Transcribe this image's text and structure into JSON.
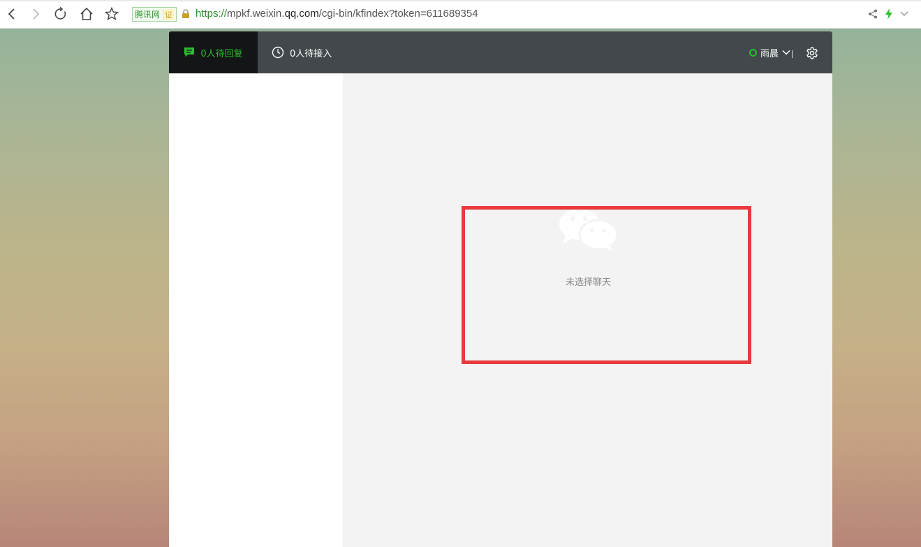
{
  "browser": {
    "cert_label": "腾讯网",
    "cert_mark": "证",
    "url_scheme": "https://",
    "url_pre": "mpkf.weixin.",
    "url_domain": "qq.com",
    "url_path": "/cgi-bin/kfindex?token=611689354"
  },
  "app": {
    "tabs": [
      {
        "label": "0人待回复",
        "icon": "chat-bubble-icon",
        "active": true
      },
      {
        "label": "0人待接入",
        "icon": "clock-icon",
        "active": false
      }
    ],
    "user": {
      "name": "雨晨",
      "status": "online"
    },
    "empty_state": {
      "text": "未选择聊天",
      "icon": "wechat-logo-icon"
    }
  },
  "colors": {
    "accent_green": "#2dbf31",
    "header_bg": "#42484b",
    "highlight_red": "#e8393c"
  }
}
